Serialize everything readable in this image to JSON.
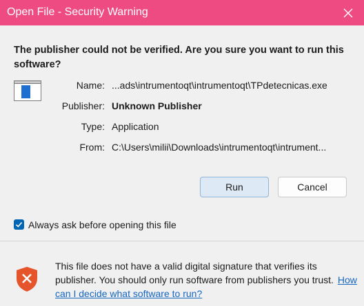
{
  "window": {
    "title": "Open File - Security Warning"
  },
  "heading": "The publisher could not be verified.  Are you sure you want to run this software?",
  "fields": {
    "name": {
      "label": "Name:",
      "value": "...ads\\intrumentoqt\\intrumentoqt\\TPdetecnicas.exe"
    },
    "publisher": {
      "label": "Publisher:",
      "value": "Unknown Publisher"
    },
    "type": {
      "label": "Type:",
      "value": "Application"
    },
    "from": {
      "label": "From:",
      "value": "C:\\Users\\milii\\Downloads\\intrumentoqt\\intrument..."
    }
  },
  "buttons": {
    "run": "Run",
    "cancel": "Cancel"
  },
  "checkbox": {
    "label": "Always ask before opening this file",
    "checked": true
  },
  "warning": {
    "text": "This file does not have a valid digital signature that verifies its publisher.  You should only run software from publishers you trust.",
    "link": "How can I decide what software to run?"
  },
  "icons": {
    "close": "close-icon",
    "file": "application-file-icon",
    "shield": "security-shield-icon",
    "check": "checkmark-icon"
  },
  "colors": {
    "titlebar": "#ee4b83",
    "accent": "#0066b4",
    "link": "#1565c0",
    "shield": "#e5542b"
  }
}
